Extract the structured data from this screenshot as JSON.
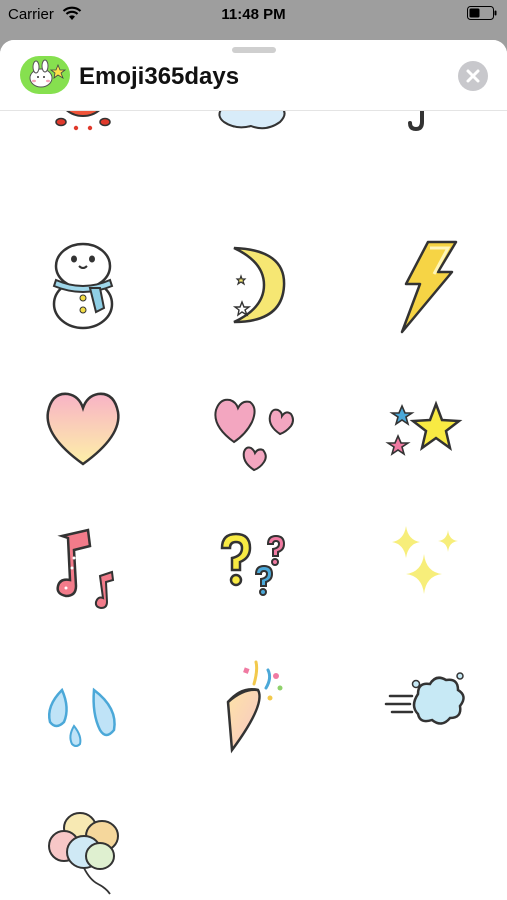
{
  "status_bar": {
    "carrier": "Carrier",
    "time": "11:48 PM"
  },
  "header": {
    "title": "Emoji365days",
    "app_icon": "bunny-icon",
    "close_icon": "close-icon"
  },
  "stickers": [
    {
      "icon": "sun-icon"
    },
    {
      "icon": "cloud-icon"
    },
    {
      "icon": "umbrella-icon"
    },
    {
      "icon": "snowman-icon"
    },
    {
      "icon": "crescent-moon-icon"
    },
    {
      "icon": "lightning-icon"
    },
    {
      "icon": "heart-icon"
    },
    {
      "icon": "hearts-icon"
    },
    {
      "icon": "stars-icon"
    },
    {
      "icon": "music-notes-icon"
    },
    {
      "icon": "question-marks-icon"
    },
    {
      "icon": "sparkles-icon"
    },
    {
      "icon": "sweat-drops-icon"
    },
    {
      "icon": "party-popper-icon"
    },
    {
      "icon": "dash-puff-icon"
    },
    {
      "icon": "balloons-icon"
    }
  ],
  "colors": {
    "app_icon_bg": "#86e04f",
    "close_button_bg": "#c8c8cc",
    "sheet_bg": "#ffffff",
    "backdrop": "#9e9e9e"
  }
}
